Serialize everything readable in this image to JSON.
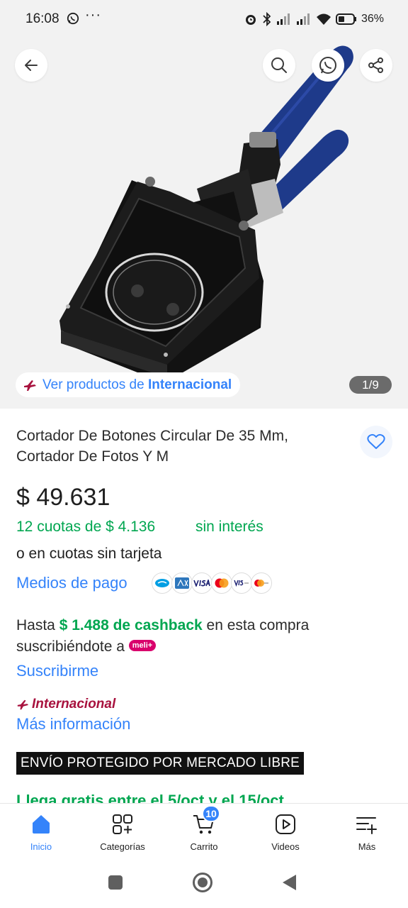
{
  "status_bar": {
    "time": "16:08",
    "dots": "···",
    "battery": "36%"
  },
  "gallery": {
    "international_prefix": "Ver productos de ",
    "international_link": "Internacional",
    "counter": "1/9",
    "colors": {
      "handle": "#1e3a8a",
      "body": "#151515"
    }
  },
  "product": {
    "title": "Cortador De Botones Circular De 35 Mm, Cortador De Fotos Y M",
    "price": "$ 49.631",
    "installments": "12 cuotas de $ 4.136",
    "interest_free": "sin interés",
    "no_card": "o en cuotas sin tarjeta",
    "payment_link": "Medios de pago",
    "payment_icons": [
      "mercadopago-icon",
      "amex-icon",
      "visa-icon",
      "mastercard-icon",
      "visa-debit-icon",
      "mastercard-debit-icon"
    ]
  },
  "cashback": {
    "prefix": "Hasta ",
    "amount": "$ 1.488 de cashback",
    "suffix": " en esta compra suscribiéndote a ",
    "badge": "meli+",
    "subscribe": "Suscribirme"
  },
  "international": {
    "brand": "Internacional",
    "more_info": "Más información"
  },
  "shipping": {
    "protected": "ENVÍO PROTEGIDO POR MERCADO LIBRE",
    "arrival": "Llega gratis entre el 5/oct y el 15/oct"
  },
  "bottom_nav": {
    "items": [
      {
        "label": "Inicio",
        "icon": "home-icon"
      },
      {
        "label": "Categorías",
        "icon": "categories-icon"
      },
      {
        "label": "Carrito",
        "icon": "cart-icon"
      },
      {
        "label": "Videos",
        "icon": "video-icon"
      },
      {
        "label": "Más",
        "icon": "menu-add-icon"
      }
    ],
    "cart_count": "10"
  },
  "colors": {
    "accent": "#3483fa",
    "green": "#00a650",
    "international": "#a8123e"
  }
}
